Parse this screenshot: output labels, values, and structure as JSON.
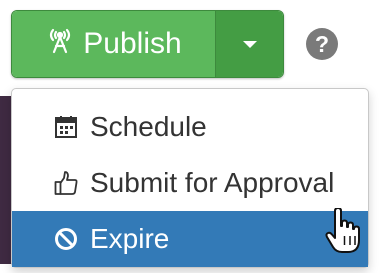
{
  "publish": {
    "label": "Publish",
    "icon": "broadcast-tower-icon",
    "color": "#5cb85c",
    "toggle_color": "#449d44"
  },
  "help": {
    "icon": "question-circle-icon",
    "glyph": "?"
  },
  "menu": {
    "items": [
      {
        "label": "Schedule",
        "icon": "calendar-icon"
      },
      {
        "label": "Submit for Approval",
        "icon": "thumbs-up-icon"
      },
      {
        "label": "Expire",
        "icon": "ban-icon",
        "highlighted": true,
        "highlight_color": "#337ab7"
      }
    ]
  }
}
